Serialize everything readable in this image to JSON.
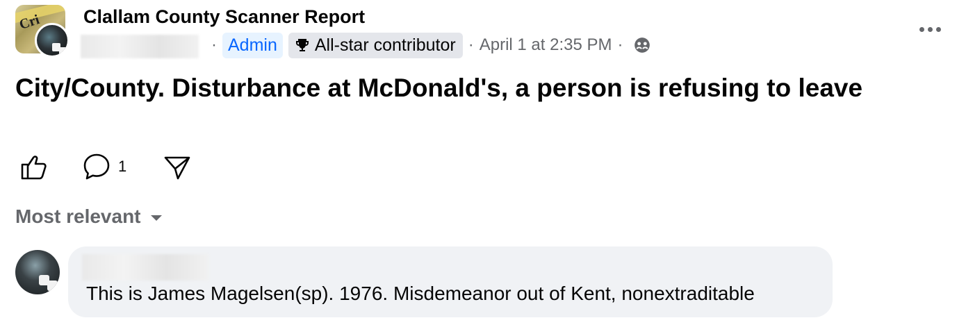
{
  "post": {
    "group_name": "Clallam County Scanner Report",
    "admin_badge": "Admin",
    "allstar_badge": "All-star contributor",
    "timestamp": "April 1 at 2:35 PM",
    "text": "City/County. Disturbance at McDonald's, a person is refusing to leave",
    "icons": {
      "more": "more-options-icon",
      "trophy": "trophy-icon",
      "audience": "group-audience-icon",
      "like": "thumbs-up-icon",
      "comment": "comment-bubble-icon",
      "share": "share-icon"
    }
  },
  "actions": {
    "comment_count": "1"
  },
  "comments": {
    "sort_label": "Most relevant",
    "items": [
      {
        "text": "This is James Magelsen(sp). 1976. Misdemeanor out of Kent, nonextraditable"
      }
    ]
  },
  "colors": {
    "accent": "#0866ff",
    "secondary_text": "#65676b",
    "bubble": "#f0f2f5"
  }
}
